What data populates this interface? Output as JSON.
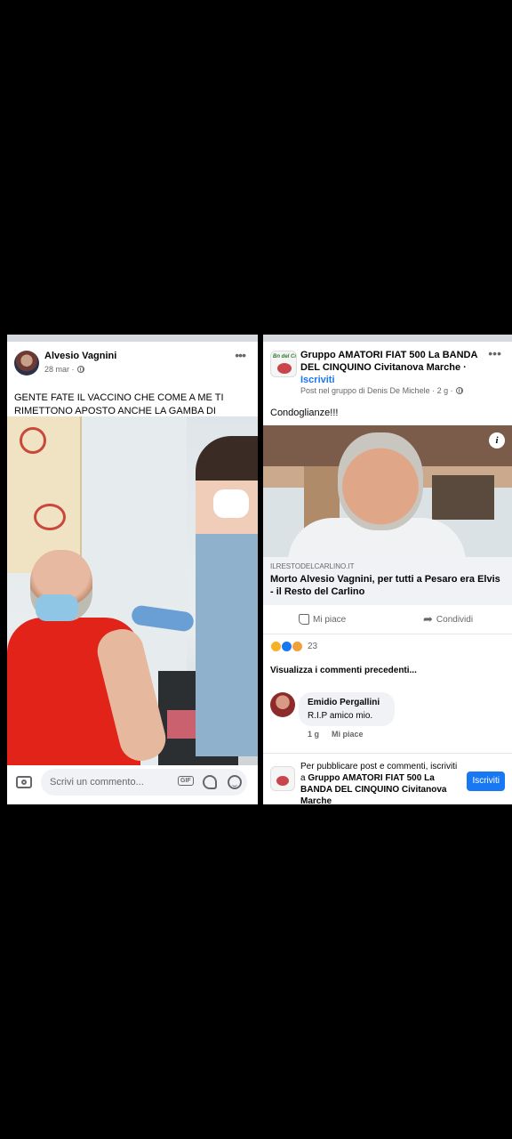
{
  "left_post": {
    "author": "Alvesio Vagnini",
    "date": "28 mar ·",
    "text": "GENTE FATE IL VACCINO CHE COME A ME TI RIMETTONO APOSTO ANCHE LA GAMBA DI MEZZO",
    "comment_placeholder": "Scrivi un commento...",
    "gif_label": "GIF"
  },
  "right_post": {
    "group_name": "Gruppo AMATORI FIAT 500 La BANDA DEL CINQUINO Civitanova Marche ·",
    "join_link": "Iscriviti",
    "meta": "Post nel gruppo di Denis De Michele · 2 g ·",
    "text": "Condoglianze!!!",
    "link_domain": "ILRESTODELCARLINO.IT",
    "link_title": "Morto Alvesio Vagnini, per tutti a Pesaro era Elvis - il Resto del Carlino",
    "like_label": "Mi piace",
    "share_label": "Condividi",
    "reaction_count": "23",
    "previous_comments": "Visualizza i commenti precedenti...",
    "comment": {
      "name": "Emidio Pergallini",
      "text": "R.I.P amico mio.",
      "time": "1 g",
      "like": "Mi piace"
    },
    "join_bar": {
      "text_prefix": "Per pubblicare post e commenti, iscriviti a",
      "group": "Gruppo AMATORI FIAT 500 La BANDA DEL CINQUINO Civitanova Marche",
      "button": "Iscriviti"
    }
  }
}
